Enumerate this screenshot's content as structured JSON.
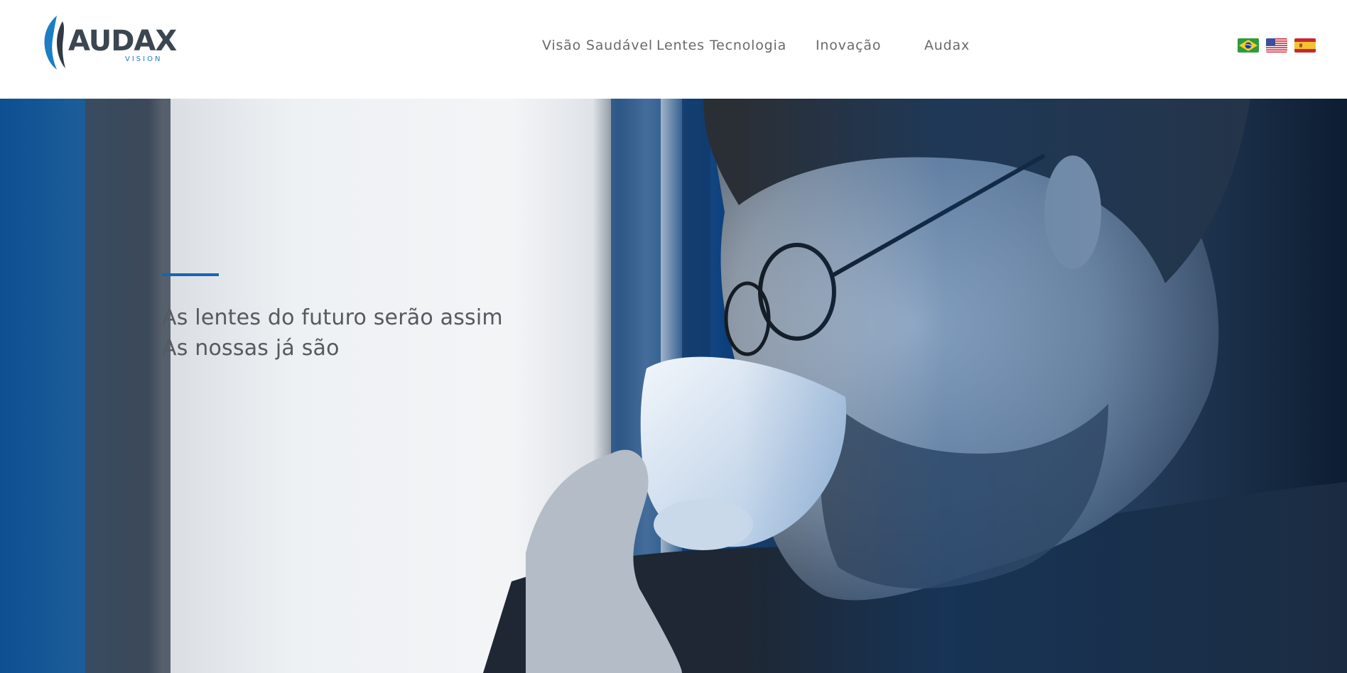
{
  "brand": {
    "name": "AUDAX",
    "sub": "VISION",
    "colors": {
      "primary": "#1a7fc4",
      "dark": "#3c4650"
    }
  },
  "nav": {
    "items": [
      {
        "label": "Visão Saudável"
      },
      {
        "label": "Lentes"
      },
      {
        "label": "Tecnologia"
      },
      {
        "label": "Inovação"
      },
      {
        "label": "Audax"
      }
    ]
  },
  "languages": [
    {
      "icon": "brazil-flag-icon"
    },
    {
      "icon": "usa-flag-icon"
    },
    {
      "icon": "spain-flag-icon"
    }
  ],
  "hero": {
    "line1": "As lentes do futuro serão assim",
    "line2": "As nossas já são",
    "accent": "#1566b0"
  }
}
